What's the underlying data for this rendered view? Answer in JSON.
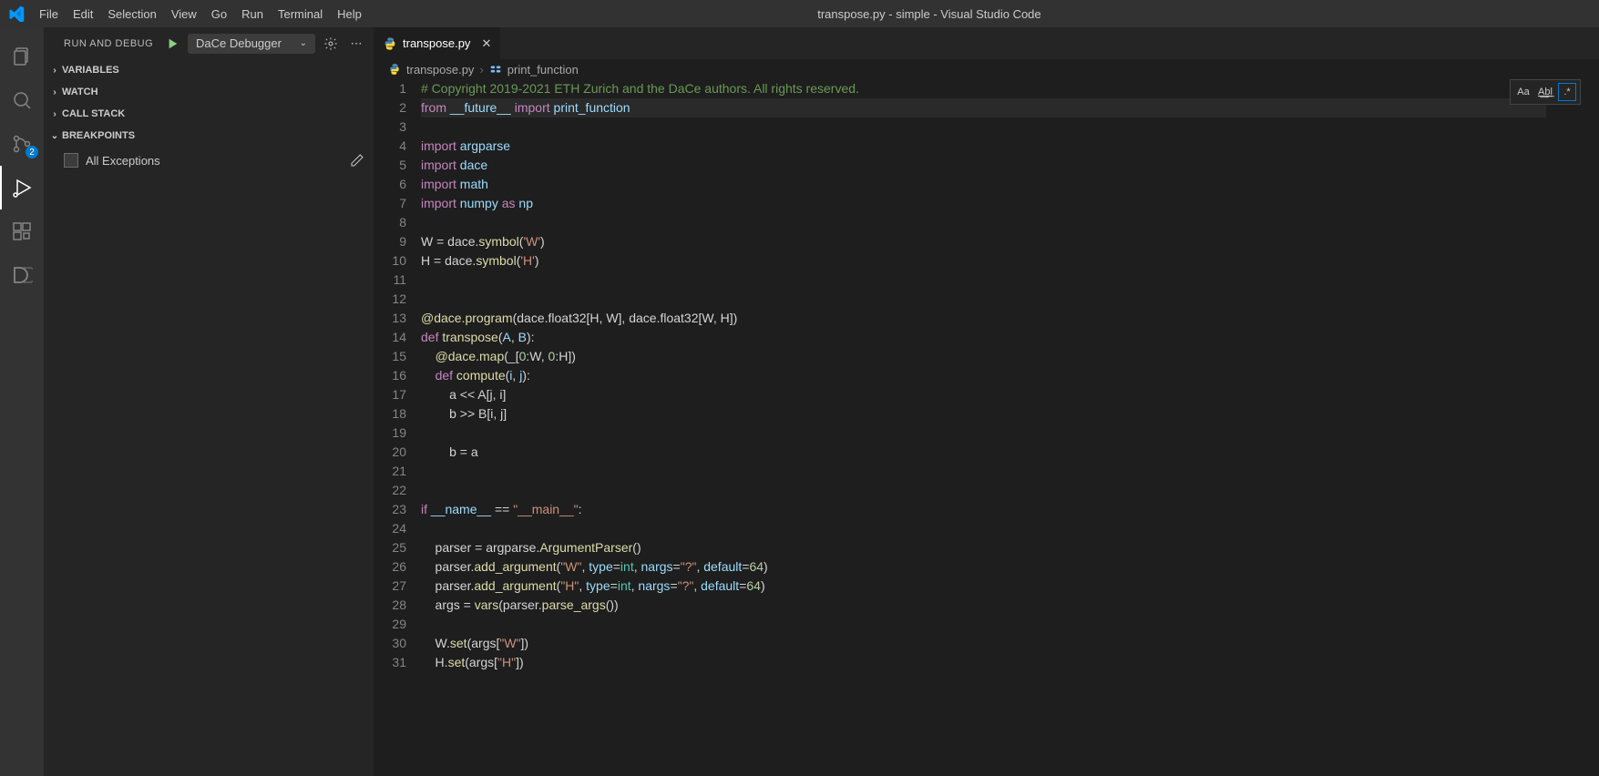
{
  "window_title": "transpose.py - simple - Visual Studio Code",
  "menu": [
    "File",
    "Edit",
    "Selection",
    "View",
    "Go",
    "Run",
    "Terminal",
    "Help"
  ],
  "activity_badge": "2",
  "run_debug_label": "RUN AND DEBUG",
  "debug_config": "DaCe Debugger",
  "panels": {
    "variables": "VARIABLES",
    "watch": "WATCH",
    "callstack": "CALL STACK",
    "breakpoints": "BREAKPOINTS"
  },
  "all_exceptions_label": "All Exceptions",
  "tab_name": "transpose.py",
  "breadcrumbs": {
    "file": "transpose.py",
    "symbol": "print_function"
  },
  "search_opts": {
    "case": "Aa",
    "word": "A͟b͟l",
    "regex": ".*"
  },
  "code_lines": [
    {
      "n": 1,
      "html": "<span class='com'># Copyright 2019-2021 ETH Zurich and the DaCe authors. All rights reserved.</span>"
    },
    {
      "n": 2,
      "cur": true,
      "html": "<span class='kw'>from</span> <span class='var'>__future__</span> <span class='kw'>import</span> <span class='var'>print_function</span>"
    },
    {
      "n": 3,
      "html": ""
    },
    {
      "n": 4,
      "html": "<span class='kw'>import</span> <span class='var'>argparse</span>"
    },
    {
      "n": 5,
      "html": "<span class='kw'>import</span> <span class='var'>dace</span>"
    },
    {
      "n": 6,
      "html": "<span class='kw'>import</span> <span class='var'>math</span>"
    },
    {
      "n": 7,
      "html": "<span class='kw'>import</span> <span class='var'>numpy</span> <span class='kw'>as</span> <span class='var'>np</span>"
    },
    {
      "n": 8,
      "html": ""
    },
    {
      "n": 9,
      "html": "W = dace.<span class='fn'>symbol</span>(<span class='str'>'W'</span>)"
    },
    {
      "n": 10,
      "html": "H = dace.<span class='fn'>symbol</span>(<span class='str'>'H'</span>)"
    },
    {
      "n": 11,
      "html": ""
    },
    {
      "n": 12,
      "html": ""
    },
    {
      "n": 13,
      "html": "<span class='dec'>@dace.program</span>(dace.float32[H, W], dace.float32[W, H])"
    },
    {
      "n": 14,
      "html": "<span class='kw'>def</span> <span class='fn'>transpose</span>(<span class='var'>A</span>, <span class='var'>B</span>):"
    },
    {
      "n": 15,
      "html": "    <span class='dec'>@dace.map</span>(_[<span class='num'>0</span>:W, <span class='num'>0</span>:H])"
    },
    {
      "n": 16,
      "html": "    <span class='kw'>def</span> <span class='fn'>compute</span>(<span class='var'>i</span>, <span class='var'>j</span>):"
    },
    {
      "n": 17,
      "html": "        a &lt;&lt; A[j, i]"
    },
    {
      "n": 18,
      "html": "        b &gt;&gt; B[i, j]"
    },
    {
      "n": 19,
      "html": ""
    },
    {
      "n": 20,
      "html": "        b = a"
    },
    {
      "n": 21,
      "html": ""
    },
    {
      "n": 22,
      "html": ""
    },
    {
      "n": 23,
      "html": "<span class='kw'>if</span> <span class='var'>__name__</span> == <span class='str'>\"__main__\"</span>:"
    },
    {
      "n": 24,
      "html": ""
    },
    {
      "n": 25,
      "html": "    parser = argparse.<span class='fn'>ArgumentParser</span>()"
    },
    {
      "n": 26,
      "html": "    parser.<span class='fn'>add_argument</span>(<span class='str'>\"W\"</span>, <span class='var'>type</span>=<span class='cls'>int</span>, <span class='var'>nargs</span>=<span class='str'>\"?\"</span>, <span class='var'>default</span>=<span class='num'>64</span>)"
    },
    {
      "n": 27,
      "html": "    parser.<span class='fn'>add_argument</span>(<span class='str'>\"H\"</span>, <span class='var'>type</span>=<span class='cls'>int</span>, <span class='var'>nargs</span>=<span class='str'>\"?\"</span>, <span class='var'>default</span>=<span class='num'>64</span>)"
    },
    {
      "n": 28,
      "html": "    args = <span class='fn'>vars</span>(parser.<span class='fn'>parse_args</span>())"
    },
    {
      "n": 29,
      "html": ""
    },
    {
      "n": 30,
      "html": "    W.<span class='fn'>set</span>(args[<span class='str'>\"W\"</span>])"
    },
    {
      "n": 31,
      "html": "    H.<span class='fn'>set</span>(args[<span class='str'>\"H\"</span>])"
    }
  ]
}
